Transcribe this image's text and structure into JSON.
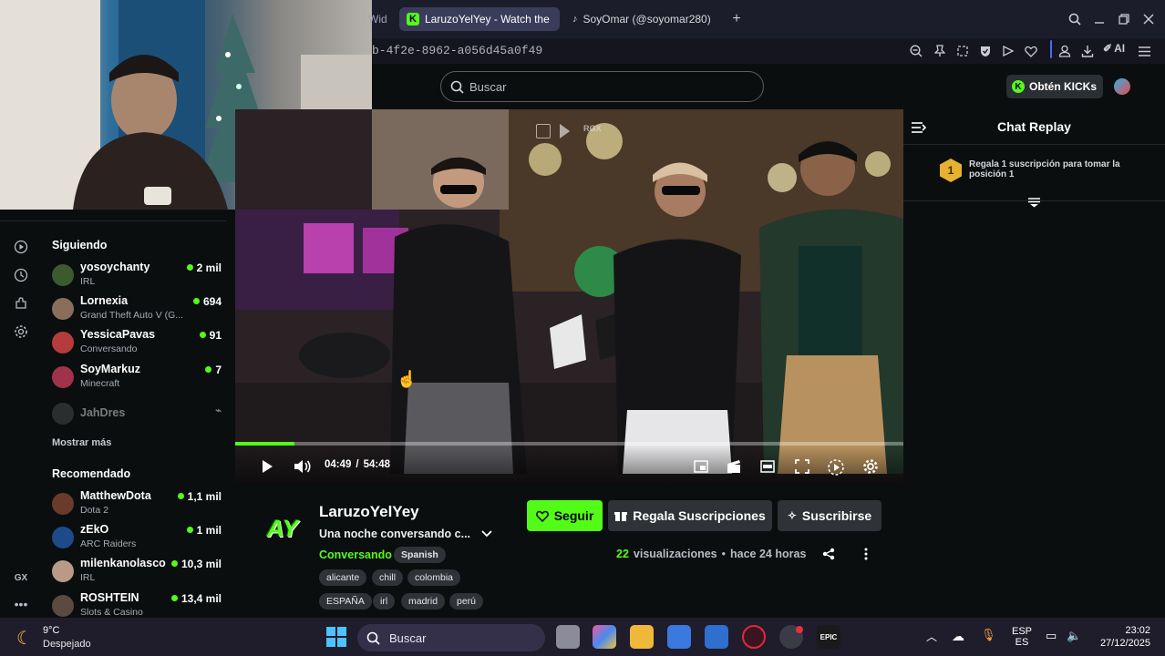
{
  "browser": {
    "tabs": [
      {
        "label": "Wid",
        "active": false
      },
      {
        "label": "LaruzoYelYey - Watch the",
        "active": true
      },
      {
        "label": "SoyOmar (@soyomar280)",
        "active": false
      }
    ],
    "url_fragment": "b-4f2e-8962-a056d45a0f49",
    "toolbar_icons": [
      "search-icon",
      "minimize-icon",
      "restore-icon",
      "close-icon",
      "zoom-out-icon",
      "pin-icon",
      "screenshot-icon",
      "shield-icon",
      "send-icon",
      "heart-icon",
      "profile-icon",
      "download-icon",
      "ai-icon",
      "menu-icon"
    ],
    "ai_label": "AI"
  },
  "header": {
    "search_placeholder": "Buscar",
    "kicks_label": "Obtén KICKs"
  },
  "sidebar": {
    "following_title": "Siguiendo",
    "following": [
      {
        "name": "yosoychanty",
        "sub": "IRL",
        "count": "2 mil",
        "avatar_color": "#3b5a2e",
        "live": true
      },
      {
        "name": "Lornexia",
        "sub": "Grand Theft Auto V (G...",
        "count": "694",
        "avatar_color": "#8a6e5a",
        "live": true
      },
      {
        "name": "YessicaPavas",
        "sub": "Conversando",
        "count": "91",
        "avatar_color": "#b43c3c",
        "live": true
      },
      {
        "name": "SoyMarkuz",
        "sub": "Minecraft",
        "count": "7",
        "avatar_color": "#a0324a",
        "live": true
      },
      {
        "name": "JahDres",
        "sub": "",
        "count": "",
        "avatar_color": "#555",
        "live": false
      }
    ],
    "show_more": "Mostrar más",
    "recommended_title": "Recomendado",
    "recommended": [
      {
        "name": "MatthewDota",
        "sub": "Dota 2",
        "count": "1,1 mil",
        "avatar_color": "#6a3a2a"
      },
      {
        "name": "zEkO",
        "sub": "ARC Raiders",
        "count": "1 mil",
        "avatar_color": "#1e4a8a"
      },
      {
        "name": "milenkanolasco",
        "sub": "IRL",
        "count": "10,3 mil",
        "avatar_color": "#b89a86"
      },
      {
        "name": "ROSHTEIN",
        "sub": "Slots & Casino",
        "count": "13,4 mil",
        "avatar_color": "#5a4a40"
      }
    ],
    "gx_label": "GX"
  },
  "player": {
    "time_current": "04:49",
    "time_separator": "/",
    "time_total": "54:48",
    "progress": 0.089,
    "rgx_label": "RGX"
  },
  "chat": {
    "title": "Chat Replay",
    "gift_rank": "1",
    "gift_text": "Regala 1 suscripción para tomar la posición 1"
  },
  "channel": {
    "name": "LaruzoYelYey",
    "logo_text": "AY",
    "stream_title": "Una noche conversando c...",
    "category": "Conversando",
    "language": "Spanish",
    "tags": [
      "alicante",
      "chill",
      "colombia",
      "ESPAÑA",
      "irl",
      "madrid",
      "perú"
    ],
    "follow_label": "Seguir",
    "gift_label": "Regala Suscripciones",
    "subscribe_label": "Suscribirse",
    "views_count": "22",
    "views_label": "visualizaciones",
    "bullet": "•",
    "time_ago": "hace 24 horas"
  },
  "taskbar": {
    "temp": "9°C",
    "weather": "Despejado",
    "search_label": "Buscar",
    "lang_top": "ESP",
    "lang_bottom": "ES",
    "time": "23:02",
    "date": "27/12/2025"
  },
  "colors": {
    "kick_green": "#53fc18",
    "background": "#0b0e0f",
    "taskbar": "#1f1c2c"
  }
}
